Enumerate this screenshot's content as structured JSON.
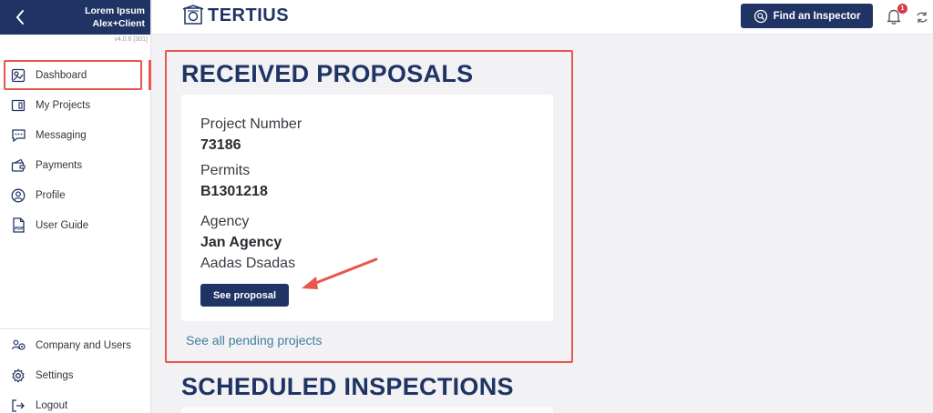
{
  "sidebar": {
    "user_name": "Lorem Ipsum",
    "user_role": "Alex+Client",
    "version": "v4.0.6 [301]",
    "items": [
      {
        "label": "Dashboard",
        "icon": "dashboard-icon"
      },
      {
        "label": "My Projects",
        "icon": "projects-icon"
      },
      {
        "label": "Messaging",
        "icon": "messaging-icon"
      },
      {
        "label": "Payments",
        "icon": "payments-icon"
      },
      {
        "label": "Profile",
        "icon": "profile-icon"
      },
      {
        "label": "User Guide",
        "icon": "pdf-icon"
      }
    ],
    "bottom_items": [
      {
        "label": "Company and Users",
        "icon": "users-icon"
      },
      {
        "label": "Settings",
        "icon": "gear-icon"
      },
      {
        "label": "Logout",
        "icon": "logout-icon"
      }
    ]
  },
  "header": {
    "logo_text": "TERTIUS",
    "find_button": "Find an Inspector",
    "notification_count": "1"
  },
  "main": {
    "received_title": "RECEIVED PROPOSALS",
    "proposal": {
      "project_number_label": "Project Number",
      "project_number": "73186",
      "permits_label": "Permits",
      "permits": "B1301218",
      "agency_label": "Agency",
      "agency_name": "Jan Agency",
      "agency_contact": "Aadas Dsadas",
      "see_button": "See proposal"
    },
    "see_all_link": "See all pending projects",
    "scheduled_title": "SCHEDULED INSPECTIONS"
  },
  "colors": {
    "navy": "#1f3464",
    "highlight": "#e8564d",
    "link": "#3f7e9b",
    "badge": "#d83a4a"
  }
}
